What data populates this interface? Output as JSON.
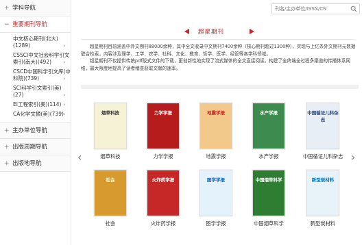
{
  "sidebar": {
    "sections": [
      {
        "label": "学科导航",
        "active": false
      },
      {
        "label": "重要期刊导航",
        "active": true
      },
      {
        "label": "主办单位导航",
        "active": false
      },
      {
        "label": "出版周期导航",
        "active": false
      },
      {
        "label": "出版地导航",
        "active": false
      }
    ],
    "items": [
      {
        "label": "中文核心期刊(北大)(1289)"
      },
      {
        "label": "CSSCI中文社会科学引文索引(南大)(492)"
      },
      {
        "label": "CSCD中国科学引文库(中科院)(739)"
      },
      {
        "label": "SCI科学引文索引(美)(27)"
      },
      {
        "label": "EI工程索引(美)(114)"
      },
      {
        "label": "CA化学文摘(美)(739)"
      }
    ]
  },
  "search": {
    "placeholder": "刊名/主办单位/ISSN/CN"
  },
  "main": {
    "title": "超星期刊",
    "intro": [
      "超星期刊目前涵盖中外文期刊88000余种，其中全文收录中文期刊7400余种（核心期刊超过1300种），实现与上亿条外文期刊元数据联合检索，内容涉及理学、工学、农学、社科、文化、教育、哲学、医学、经管等各学科领域。",
      "超星期刊不仅提供传统pdf版式文件的下载，更创新性地实现了流式媒体的全文直接阅读，构建了全终端全过程多渠道的传播体系网络，最大限度地提高了读者稽查获取文献的速率。"
    ],
    "journals": [
      {
        "name": "烟草科技",
        "cover_title": "烟草科技",
        "bg": "#f6f2d6",
        "fg": "#333"
      },
      {
        "name": "力学学报",
        "cover_title": "力学学报",
        "bg": "#b71c1c",
        "fg": "#fff"
      },
      {
        "name": "地震学报",
        "cover_title": "地震学报",
        "bg": "#f3c98b",
        "fg": "#c62828"
      },
      {
        "name": "水产学报",
        "cover_title": "水产学报",
        "bg": "#3d8b4f",
        "fg": "#fff"
      },
      {
        "name": "中国循证儿科杂志",
        "cover_title": "中国循证儿科杂志",
        "bg": "#e8eef6",
        "fg": "#2b4a7a"
      },
      {
        "name": "社会",
        "cover_title": "社会",
        "bg": "#d69a2e",
        "fg": "#fff"
      },
      {
        "name": "火炸药学报",
        "cover_title": "火炸药学报",
        "bg": "#c62828",
        "fg": "#fff"
      },
      {
        "name": "图学学报",
        "cover_title": "图学学报",
        "bg": "#e3f2fb",
        "fg": "#1565c0"
      },
      {
        "name": "中国烟草科学",
        "cover_title": "中国烟草科学",
        "bg": "#2e7d32",
        "fg": "#fff"
      },
      {
        "name": "新型炭材料",
        "cover_title": "新型炭材料",
        "bg": "#e7f3f8",
        "fg": "#0277bd"
      }
    ]
  }
}
